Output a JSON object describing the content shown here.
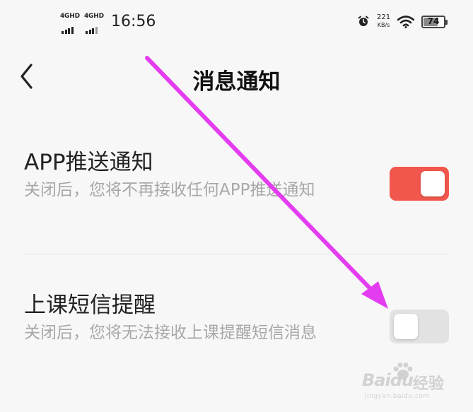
{
  "status_bar": {
    "network_1": "4GHD",
    "network_2": "4GHD",
    "time": "16:56",
    "speed_value": "221",
    "speed_unit": "KB/s",
    "battery": "74",
    "battery_level": 0.74,
    "icons": [
      "alarm-icon",
      "wifi-icon",
      "battery-icon"
    ]
  },
  "nav": {
    "back_icon": "chevron-left-icon",
    "title": "消息通知"
  },
  "settings": [
    {
      "title": "APP推送通知",
      "description": "关闭后，您将不再接收任何APP推送通知",
      "enabled": true
    },
    {
      "title": "上课短信提醒",
      "description": "关闭后，您将无法接收上课提醒短信消息",
      "enabled": false
    }
  ],
  "colors": {
    "toggle_on": "#f2574d",
    "toggle_off": "#e2e2e2",
    "annotation_arrow": "#e43cf0",
    "background": "#f7f7f7"
  },
  "watermark": {
    "brand": "Baidu",
    "product": "经验",
    "url": "jingyan.baidu.com"
  }
}
